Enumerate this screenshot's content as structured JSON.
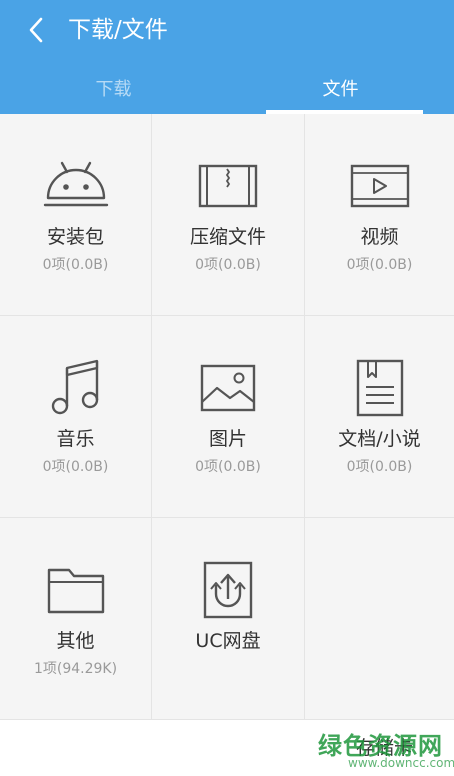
{
  "header": {
    "title": "下载/文件",
    "tabs": [
      {
        "label": "下载",
        "active": false
      },
      {
        "label": "文件",
        "active": true
      }
    ],
    "bg_color": "#4aa3e6"
  },
  "categories": [
    {
      "label": "安装包",
      "count": "0项(0.0B)",
      "icon": "android-icon"
    },
    {
      "label": "压缩文件",
      "count": "0项(0.0B)",
      "icon": "archive-icon"
    },
    {
      "label": "视频",
      "count": "0项(0.0B)",
      "icon": "video-icon"
    },
    {
      "label": "音乐",
      "count": "0项(0.0B)",
      "icon": "music-icon"
    },
    {
      "label": "图片",
      "count": "0项(0.0B)",
      "icon": "image-icon"
    },
    {
      "label": "文档/小说",
      "count": "0项(0.0B)",
      "icon": "document-icon"
    },
    {
      "label": "其他",
      "count": "1项(94.29K)",
      "icon": "folder-icon"
    },
    {
      "label": "UC网盘",
      "count": "",
      "icon": "cloud-upload-icon"
    }
  ],
  "footer": {
    "storage_label": "存储卡"
  },
  "watermark": {
    "main": "绿色资源网",
    "sub": "www.downcc.com"
  }
}
